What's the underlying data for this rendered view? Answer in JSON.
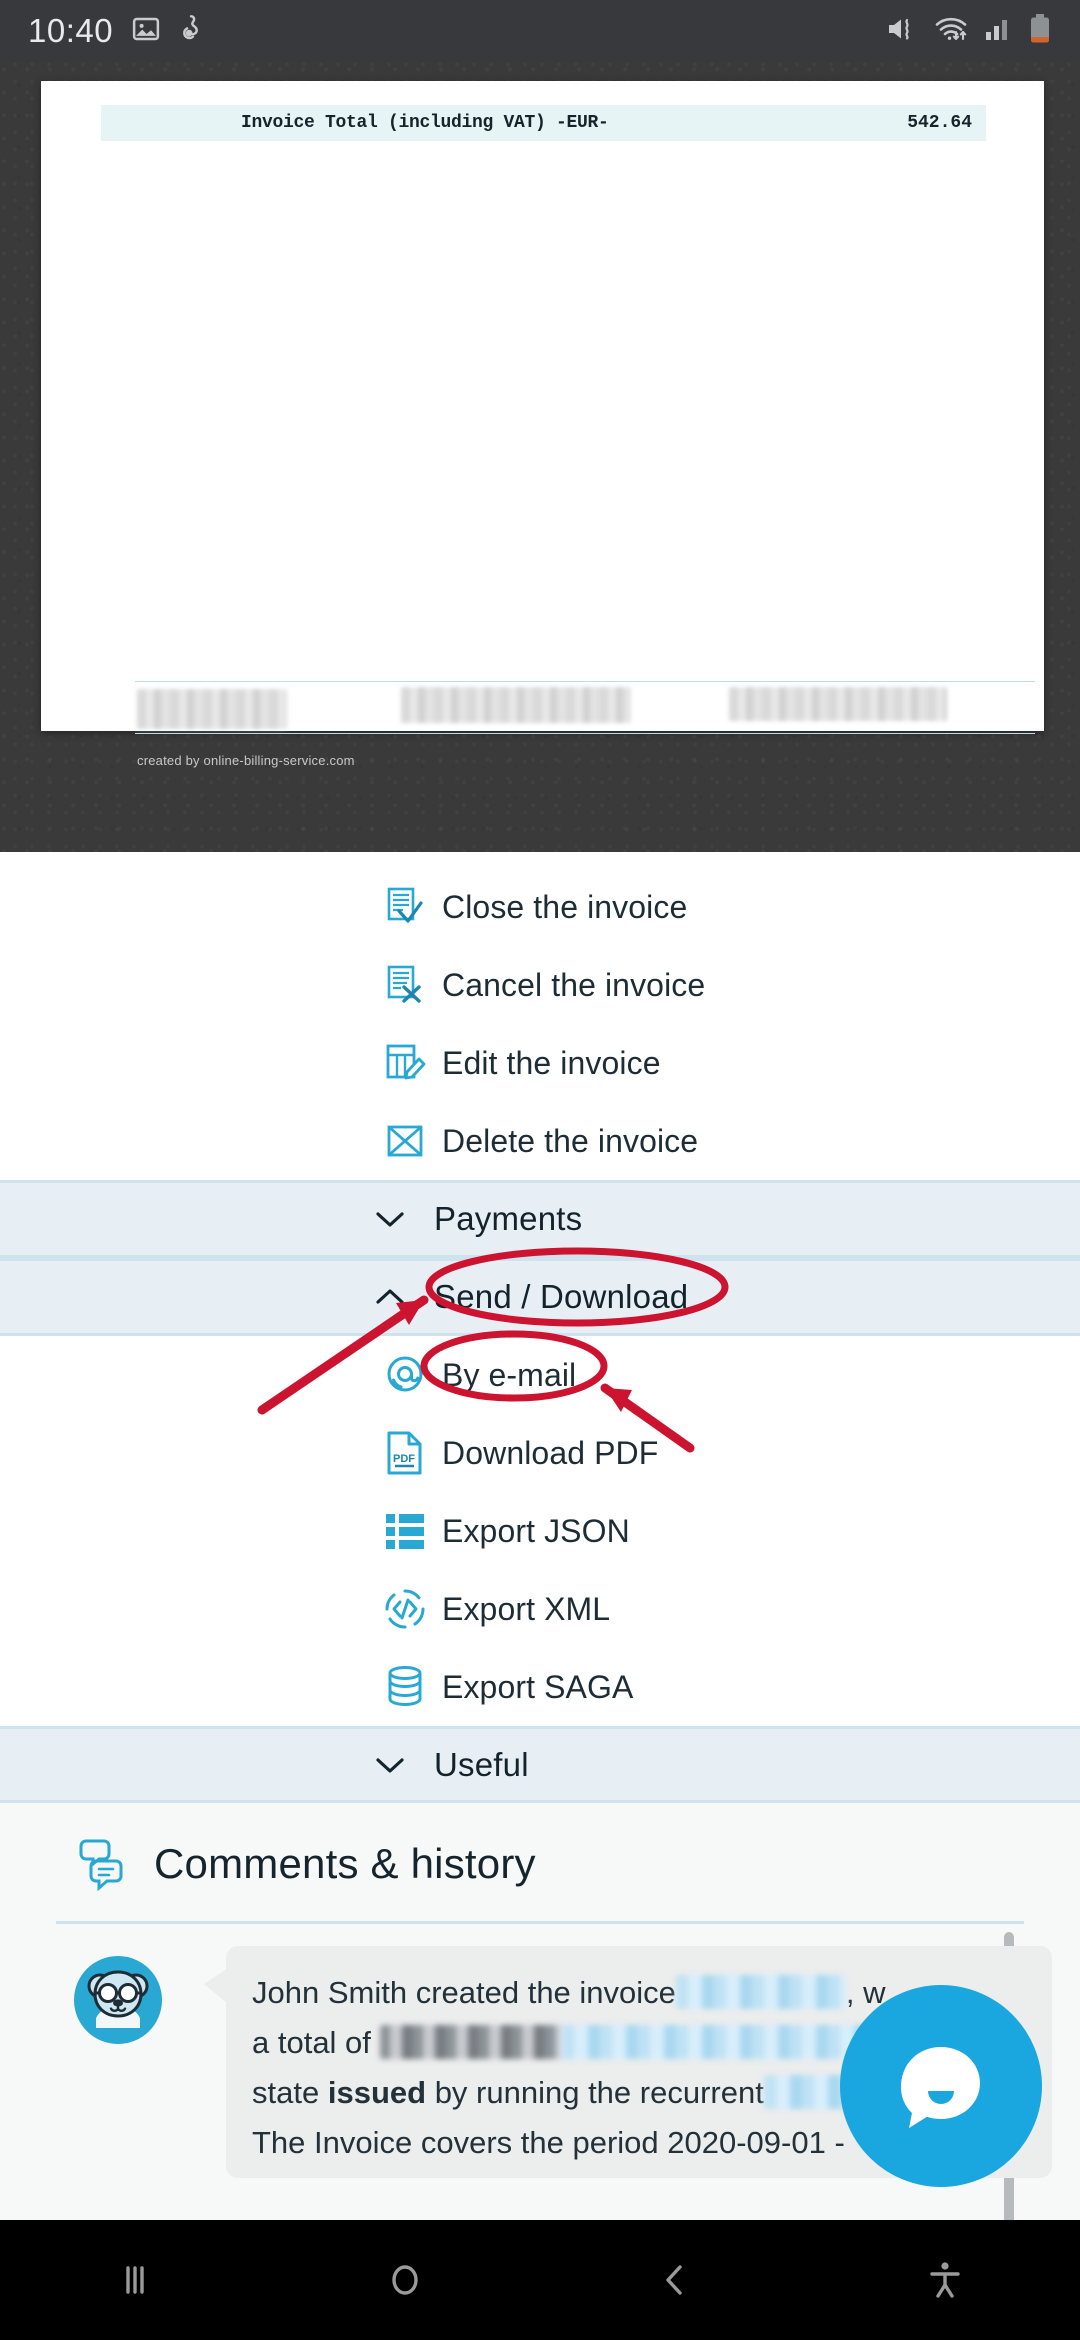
{
  "status_bar": {
    "time": "10:40",
    "left_icons": [
      "image-icon",
      "download-icon"
    ],
    "right_icons": [
      "mute-vibrate-icon",
      "wifi-icon",
      "signal-icon",
      "battery-low-icon"
    ]
  },
  "invoice_preview": {
    "total_label": "Invoice Total (including VAT) -EUR-",
    "total_value": "542.64",
    "footer_credit": "created by online-billing-service.com",
    "redacted_blocks": 3
  },
  "actions": [
    {
      "label": "Close the invoice",
      "icon": "invoice-check-icon"
    },
    {
      "label": "Cancel the invoice",
      "icon": "invoice-cross-icon"
    },
    {
      "label": "Edit the invoice",
      "icon": "invoice-pencil-icon"
    },
    {
      "label": "Delete the invoice",
      "icon": "invoice-delete-icon"
    }
  ],
  "sections": [
    {
      "title": "Payments",
      "expanded": false,
      "chevron": "chevron-down-icon"
    },
    {
      "title": "Send / Download",
      "expanded": true,
      "chevron": "chevron-up-icon"
    },
    {
      "title": "Useful",
      "expanded": false,
      "chevron": "chevron-down-icon"
    }
  ],
  "send_download_items": [
    {
      "label": "By e-mail",
      "icon": "at-sign-icon"
    },
    {
      "label": "Download PDF",
      "icon": "pdf-file-icon"
    },
    {
      "label": "Export JSON",
      "icon": "list-blocks-icon"
    },
    {
      "label": "Export XML",
      "icon": "code-circle-icon"
    },
    {
      "label": "Export SAGA",
      "icon": "database-icon"
    }
  ],
  "comments": {
    "title": "Comments & history",
    "icon": "speech-bubbles-icon",
    "avatar": "bear-avatar-icon",
    "entry_line_1_a": "John Smith created the invoice",
    "entry_line_1_b": ", w",
    "entry_line_2_a": "a total of",
    "entry_line_3_a": "state",
    "entry_line_3_b": "issued",
    "entry_line_3_c": "by running the recurrent",
    "entry_line_4": "The Invoice covers the period 2020-09-01 -"
  },
  "chat_fab": {
    "icon": "chat-bubble-icon",
    "color": "#1aa7e0"
  },
  "annotations": {
    "color": "#cc1330",
    "ellipse_targets": [
      "Send / Download",
      "By e-mail"
    ],
    "arrow_count": 2
  },
  "nav_bar": {
    "buttons": [
      {
        "icon": "recents-icon"
      },
      {
        "icon": "home-icon"
      },
      {
        "icon": "back-icon"
      },
      {
        "icon": "accessibility-icon"
      }
    ]
  },
  "colors": {
    "accent_cyan": "#29a8d4",
    "section_bg": "#e7eff5",
    "section_border": "#cfe3ef",
    "text_dark": "#16252d",
    "annotation_red": "#cc1330"
  }
}
